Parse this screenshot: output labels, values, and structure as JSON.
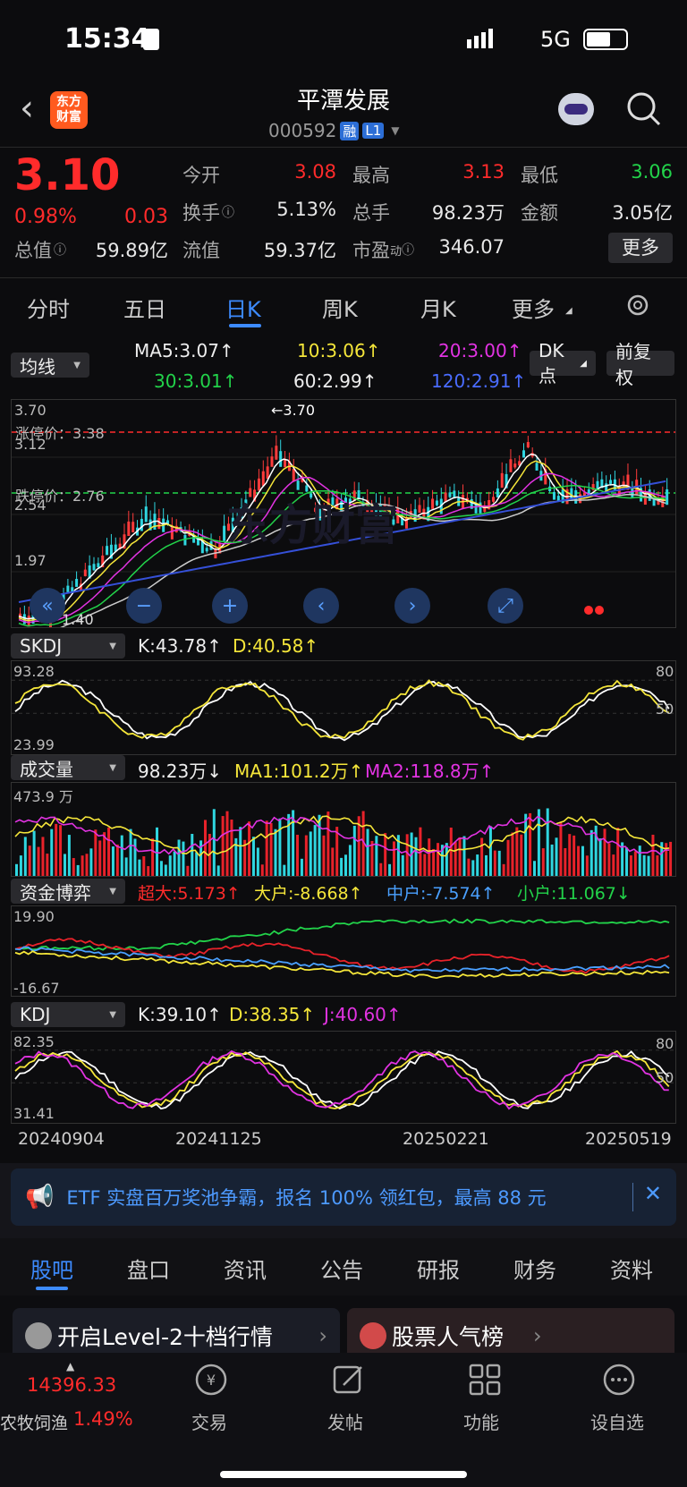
{
  "status": {
    "time": "15:34",
    "net": "5G"
  },
  "header": {
    "name": "平潭发展",
    "code": "000592",
    "tag1": "融",
    "tag2": "L1",
    "logo_l1": "东方",
    "logo_l2": "财富"
  },
  "quote": {
    "price": "3.10",
    "pct": "0.98%",
    "chg": "0.03",
    "open_l": "今开",
    "open_v": "3.08",
    "high_l": "最高",
    "high_v": "3.13",
    "low_l": "最低",
    "low_v": "3.06",
    "turn_l": "换手",
    "turn_v": "5.13%",
    "vol_l": "总手",
    "vol_v": "98.23万",
    "amt_l": "金额",
    "amt_v": "3.05亿",
    "mcap_l": "总值",
    "mcap_v": "59.89亿",
    "fcap_l": "流值",
    "fcap_v": "59.37亿",
    "pe_l": "市盈",
    "pe_sup": "动",
    "pe_v": "346.07",
    "more": "更多"
  },
  "tabs": [
    "分时",
    "五日",
    "日K",
    "周K",
    "月K",
    "更多"
  ],
  "ma": {
    "sel": "均线",
    "ma5": "MA5:3.07↑",
    "ma10": "10:3.06↑",
    "ma20": "20:3.00↑",
    "ma30": "30:3.01↑",
    "ma60": "60:2.99↑",
    "ma120": "120:2.91↑",
    "dk": "DK点",
    "fq": "前复权"
  },
  "kline": {
    "y_top": "3.70",
    "y_2": "3.12",
    "y_3": "2.54",
    "y_4": "1.97",
    "y_low": "1.40",
    "limit_up": "涨停价：3.38",
    "limit_down": "跌停价：2.76",
    "peak": "←3.70",
    "low_mark": "1.40",
    "watermark": "东方财富"
  },
  "skdj": {
    "sel": "SKDJ",
    "k": "K:43.78↑",
    "d": "D:40.58↑",
    "y_top": "93.28",
    "y_bot": "23.99",
    "r80": "80",
    "r50": "50"
  },
  "vol": {
    "sel": "成交量",
    "v": "98.23万↓",
    "ma1": "MA1:101.2万↑",
    "ma2": "MA2:118.8万↑",
    "y_top": "473.9 万"
  },
  "fund": {
    "sel": "资金博弈",
    "cd": "超大:5.173↑",
    "dh": "大户:-8.668↑",
    "zh": "中户:-7.574↑",
    "xh": "小户:11.067↓",
    "y_top": "19.90",
    "y_bot": "-16.67"
  },
  "kdj": {
    "sel": "KDJ",
    "k": "K:39.10↑",
    "d": "D:38.35↑",
    "j": "J:40.60↑",
    "y_top": "82.35",
    "y_bot": "31.41",
    "r80": "80",
    "r50": "50"
  },
  "dates": [
    "20240904",
    "20241125",
    "20250221",
    "20250519"
  ],
  "banner": {
    "text": "ETF 实盘百万奖池争霸，报名 100% 领红包，最高 88 元"
  },
  "subtabs": [
    "股吧",
    "盘口",
    "资讯",
    "公告",
    "研报",
    "财务",
    "资料"
  ],
  "promo": {
    "a": "开启Level-2十档行情",
    "b": "股票人气榜"
  },
  "bottom": {
    "index_v": "14396.33",
    "index_n": "农牧饲渔",
    "index_p": "1.49%",
    "trade": "交易",
    "post": "发帖",
    "func": "功能",
    "fav": "设自选"
  },
  "colors": {
    "up": "#ff2b2b",
    "down": "#22d34a",
    "accent": "#3d8bff"
  }
}
